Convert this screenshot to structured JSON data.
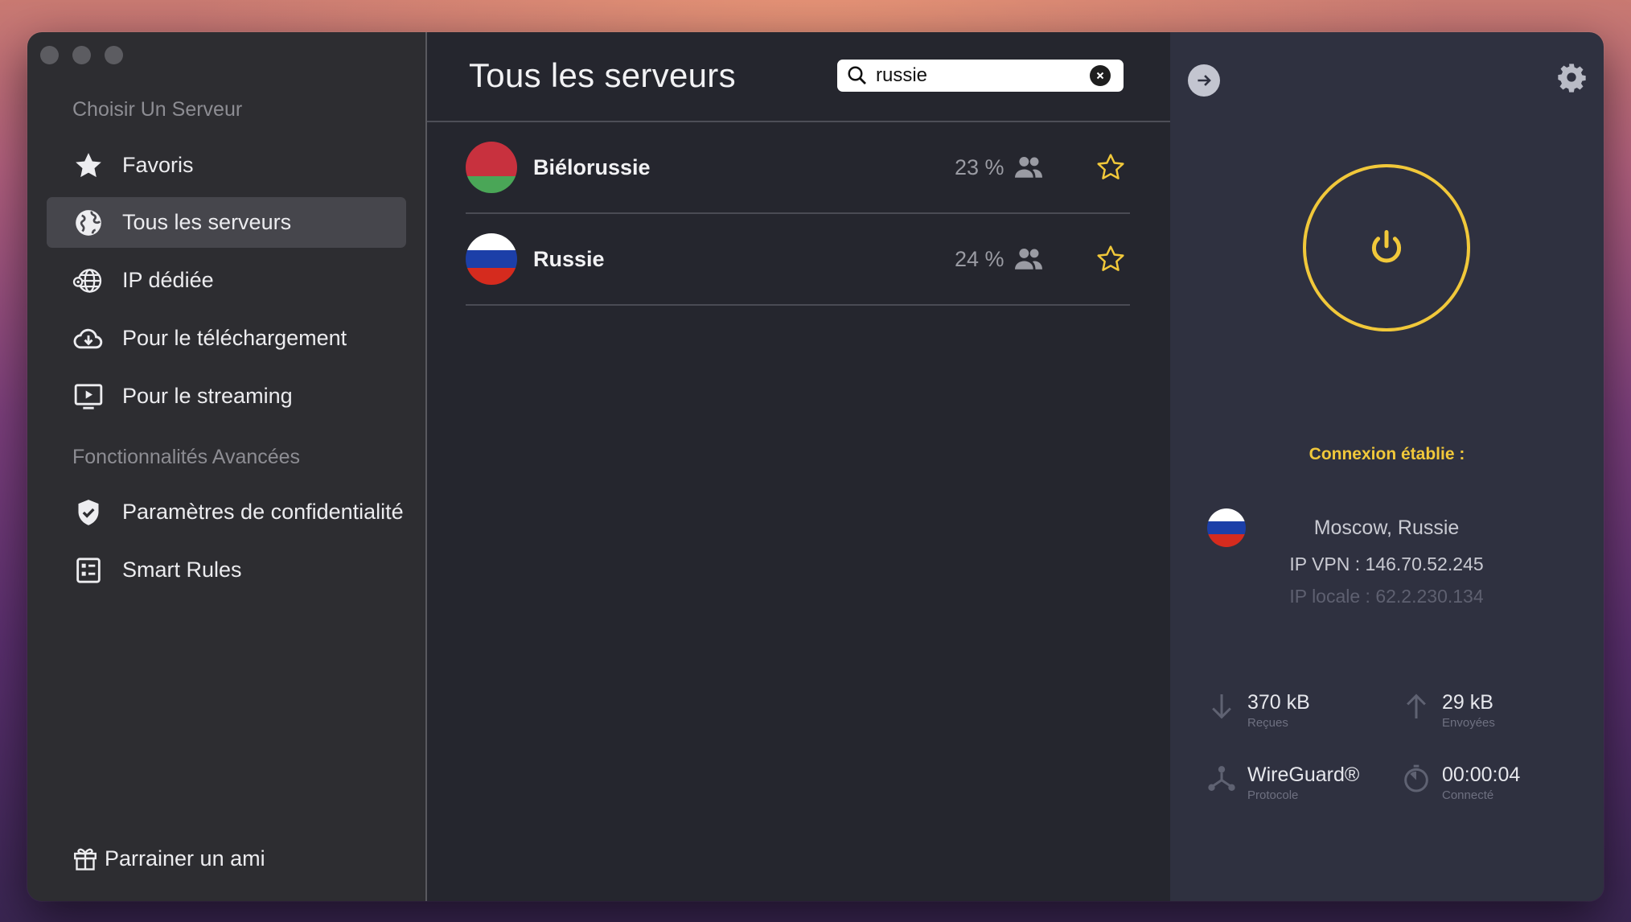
{
  "sidebar": {
    "section_choose": "Choisir Un Serveur",
    "items": [
      {
        "label": "Favoris",
        "icon": "star-icon"
      },
      {
        "label": "Tous les serveurs",
        "icon": "globe-icon",
        "active": true
      },
      {
        "label": "IP dédiée",
        "icon": "globe-pin-icon"
      },
      {
        "label": "Pour le téléchargement",
        "icon": "cloud-download-icon"
      },
      {
        "label": "Pour le streaming",
        "icon": "play-screen-icon"
      }
    ],
    "section_advanced": "Fonctionnalités Avancées",
    "advanced_items": [
      {
        "label": "Paramètres de confidentialité",
        "icon": "shield-check-icon"
      },
      {
        "label": "Smart Rules",
        "icon": "rules-icon"
      }
    ],
    "referral": "Parrainer un ami"
  },
  "main": {
    "title": "Tous les serveurs",
    "search": {
      "value": "russie"
    },
    "servers": [
      {
        "name": "Biélorussie",
        "load": "23 %",
        "flag_colors": [
          "#c8313e",
          "#c8313e",
          "#4aa657"
        ]
      },
      {
        "name": "Russie",
        "load": "24 %",
        "flag_colors": [
          "#ffffff",
          "#1c3fa8",
          "#d52b1e"
        ]
      }
    ]
  },
  "panel": {
    "status": "Connexion établie :",
    "location": "Moscow, Russie",
    "ip_vpn": "IP VPN : 146.70.52.245",
    "ip_local": "IP locale : 62.2.230.134",
    "stats": {
      "received": {
        "value": "370 kB",
        "label": "Reçues"
      },
      "sent": {
        "value": "29 kB",
        "label": "Envoyées"
      },
      "protocol": {
        "value": "WireGuard®",
        "label": "Protocole"
      },
      "connected": {
        "value": "00:00:04",
        "label": "Connecté"
      }
    }
  },
  "colors": {
    "accent": "#f1c83a",
    "sidebar_bg": "#2d2d31",
    "main_bg": "#25262e",
    "panel_bg": "#2f3140"
  }
}
